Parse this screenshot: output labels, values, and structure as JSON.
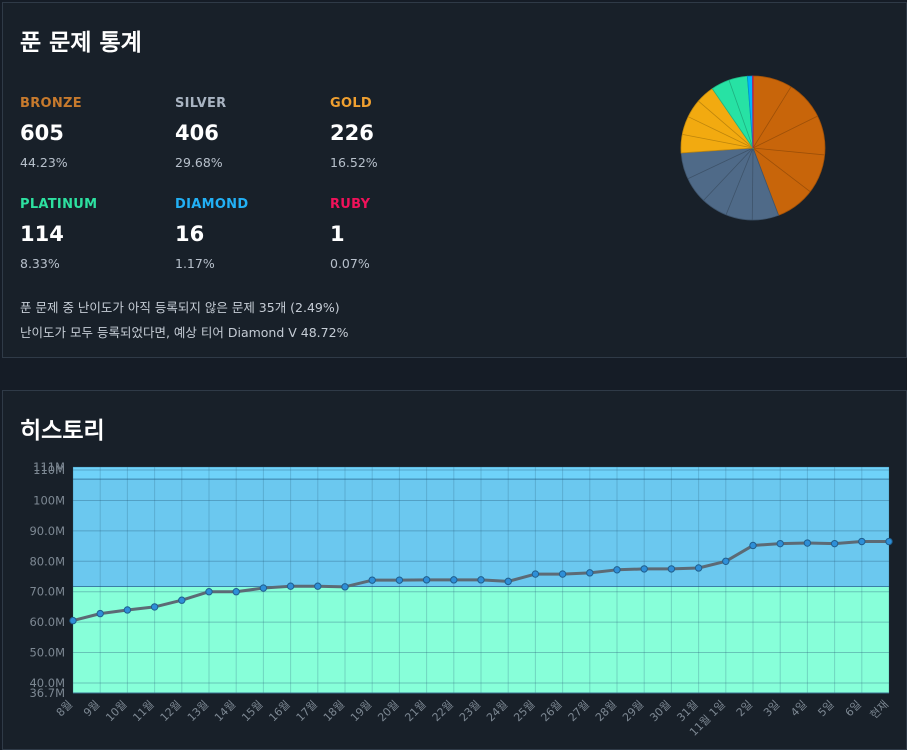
{
  "stats": {
    "title": "푼 문제 통계",
    "tiers": [
      {
        "name": "BRONZE",
        "count": "605",
        "percent": "44.23%",
        "color": "#c77a2d"
      },
      {
        "name": "SILVER",
        "count": "406",
        "percent": "29.68%",
        "color": "#a9b4c2"
      },
      {
        "name": "GOLD",
        "count": "226",
        "percent": "16.52%",
        "color": "#f0a030"
      },
      {
        "name": "PLATINUM",
        "count": "114",
        "percent": "8.33%",
        "color": "#2de0a0"
      },
      {
        "name": "DIAMOND",
        "count": "16",
        "percent": "1.17%",
        "color": "#22b0f5"
      },
      {
        "name": "RUBY",
        "count": "1",
        "percent": "0.07%",
        "color": "#f0125a"
      }
    ],
    "unrated_note": "푼 문제 중 난이도가 아직 등록되지 않은 문제 35개 (2.49%)",
    "expected_note": "난이도가 모두 등록되었다면, 예상 티어 Diamond V 48.72%"
  },
  "history": {
    "title": "히스토리"
  },
  "chart_data": [
    {
      "type": "pie",
      "title": "",
      "slices": [
        {
          "label": "BRONZE",
          "value": 605,
          "color": "#c8650a"
        },
        {
          "label": "SILVER",
          "value": 406,
          "color": "#4f6a88"
        },
        {
          "label": "GOLD",
          "value": 226,
          "color": "#f2aa10"
        },
        {
          "label": "PLATINUM",
          "value": 114,
          "color": "#27e2a4"
        },
        {
          "label": "DIAMOND",
          "value": 16,
          "color": "#00b4fc"
        },
        {
          "label": "RUBY",
          "value": 1,
          "color": "#ff0062"
        }
      ]
    },
    {
      "type": "line",
      "title": "",
      "xlabel": "",
      "ylabel": "",
      "x": [
        "8월",
        "9월",
        "10월",
        "11월",
        "12월",
        "13월",
        "14월",
        "15월",
        "16월",
        "17월",
        "18월",
        "19월",
        "20월",
        "21월",
        "22월",
        "23월",
        "24월",
        "25월",
        "26월",
        "27월",
        "28월",
        "29월",
        "30월",
        "31월",
        "11월 1일",
        "2일",
        "3일",
        "4일",
        "5일",
        "6일",
        "현재"
      ],
      "values": [
        60.5,
        62.8,
        64.0,
        65.0,
        67.2,
        70.0,
        70.0,
        71.2,
        71.8,
        71.8,
        71.6,
        73.8,
        73.8,
        73.9,
        73.9,
        73.9,
        73.4,
        75.8,
        75.8,
        76.2,
        77.2,
        77.5,
        77.5,
        77.8,
        80.0,
        85.2,
        85.8,
        86.0,
        85.8,
        86.5,
        86.5
      ],
      "series_color": "#5c6a75",
      "point_color": "#2e8fd8",
      "ylim": [
        36.7,
        111
      ],
      "yticks": [
        "36.7M",
        "40.0M",
        "50.0M",
        "60.0M",
        "70.0M",
        "80.0M",
        "90.0M",
        "100M",
        "110M",
        "111M"
      ],
      "ytick_values": [
        36.7,
        40,
        50,
        60,
        70,
        80,
        90,
        100,
        110,
        111
      ],
      "bands": [
        {
          "from": 36.7,
          "to": 71.7,
          "color": "#87ffd9"
        },
        {
          "from": 71.7,
          "to": 107,
          "color": "#6bc8ef"
        },
        {
          "from": 107,
          "to": 111,
          "color": "#6fd2f9"
        }
      ],
      "grid": true
    }
  ]
}
